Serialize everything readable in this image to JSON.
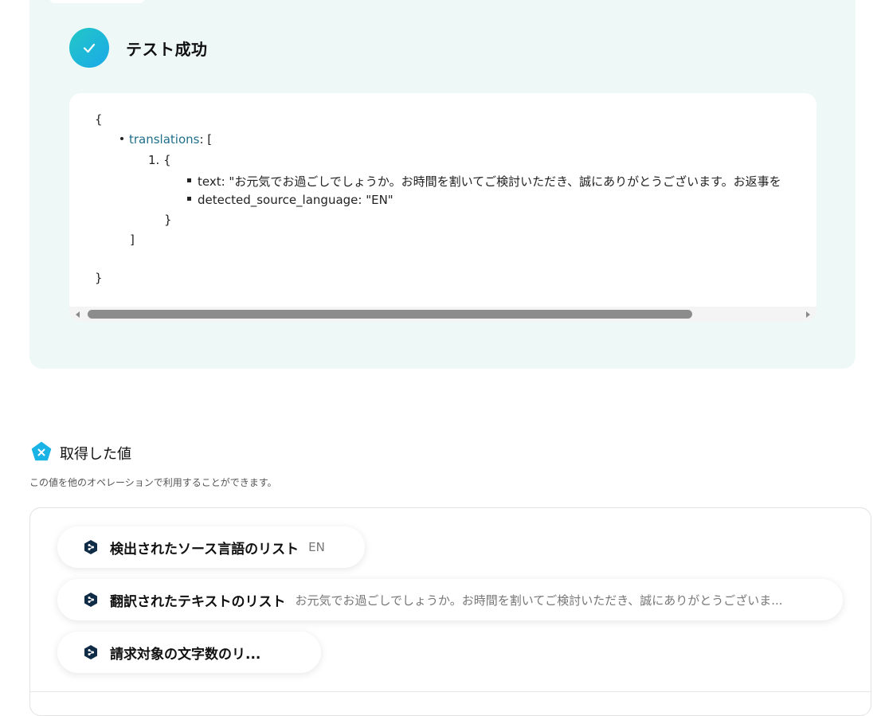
{
  "result": {
    "title": "テスト成功",
    "json": {
      "open_brace": "{",
      "translations_key": "translations",
      "translations_open": ": [",
      "item_open": "1. {",
      "text_line": "text: \"お元気でお過ごしでしょうか。お時間を割いてご検討いただき、誠にありがとうございます。お返事を",
      "lang_line": "detected_source_language: \"EN\"",
      "item_close": "}",
      "array_close": "]",
      "close_brace": "}"
    }
  },
  "values_section": {
    "title": "取得した値",
    "description": "この値を他のオペレーションで利用することができます。",
    "items": [
      {
        "label": "検出されたソース言語のリスト",
        "value": "EN"
      },
      {
        "label": "翻訳されたテキストのリスト",
        "value": "お元気でお過ごしでしょうか。お時間を割いてご検討いただき、誠にありがとうございま..."
      },
      {
        "label": "請求対象の文字数のリ...",
        "value": ""
      }
    ]
  },
  "colors": {
    "panel_bg": "#eef8f6",
    "check_gradient_start": "#23c7c6",
    "check_gradient_end": "#1aa9e8",
    "json_key": "#1f6f8b",
    "section_icon": "#19b3e6",
    "pill_icon": "#0f2b46"
  },
  "icons": {
    "success": "check-circle-icon",
    "section": "pentagon-x-icon",
    "pill": "deepl-hexagon-icon"
  }
}
